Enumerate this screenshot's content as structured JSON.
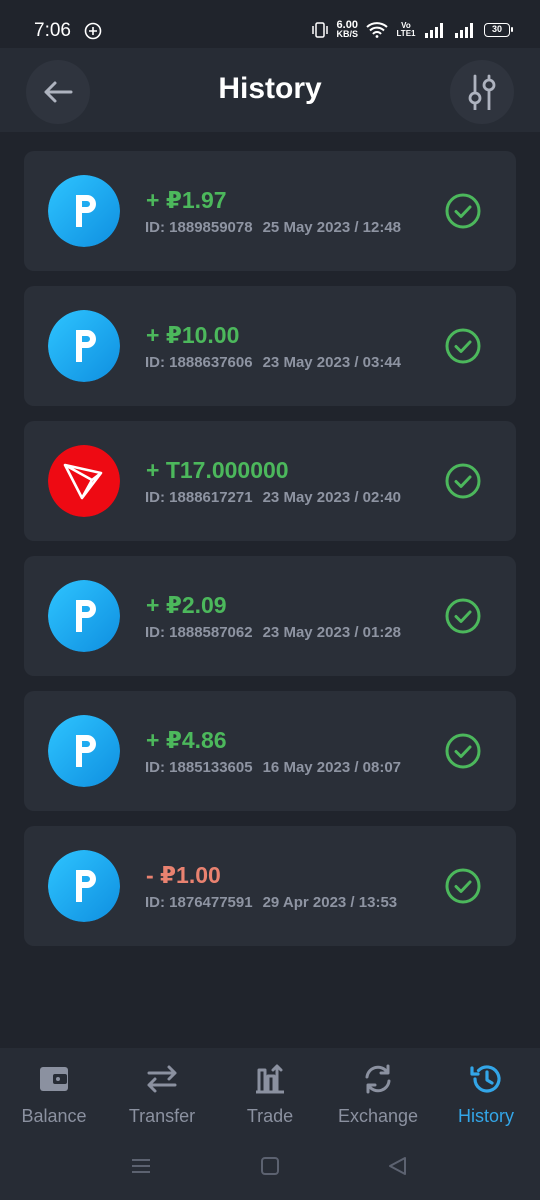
{
  "status_bar": {
    "time": "7:06",
    "speed_value": "6.00",
    "speed_unit": "KB/S",
    "network_label": "Vo LTE1",
    "battery": "30"
  },
  "header": {
    "title": "History"
  },
  "transactions": [
    {
      "icon": "p-currency-icon",
      "amount": "+ ₽1.97",
      "direction": "in",
      "id": "ID: 1889859078",
      "datetime": "25 May 2023 / 12:48"
    },
    {
      "icon": "p-currency-icon",
      "amount": "+ ₽10.00",
      "direction": "in",
      "id": "ID: 1888637606",
      "datetime": "23 May 2023 / 03:44"
    },
    {
      "icon": "tron-icon",
      "amount": "+ T17.000000",
      "direction": "in",
      "id": "ID: 1888617271",
      "datetime": "23 May 2023 / 02:40"
    },
    {
      "icon": "p-currency-icon",
      "amount": "+ ₽2.09",
      "direction": "in",
      "id": "ID: 1888587062",
      "datetime": "23 May 2023 / 01:28"
    },
    {
      "icon": "p-currency-icon",
      "amount": "+ ₽4.86",
      "direction": "in",
      "id": "ID: 1885133605",
      "datetime": "16 May 2023 / 08:07"
    },
    {
      "icon": "p-currency-icon",
      "amount": "- ₽1.00",
      "direction": "out",
      "id": "ID: 1876477591",
      "datetime": "29 Apr 2023 / 13:53"
    }
  ],
  "bottom_nav": {
    "items": [
      {
        "label": "Balance",
        "icon": "wallet-icon"
      },
      {
        "label": "Transfer",
        "icon": "transfer-arrows-icon"
      },
      {
        "label": "Trade",
        "icon": "trade-icon"
      },
      {
        "label": "Exchange",
        "icon": "exchange-icon"
      },
      {
        "label": "History",
        "icon": "history-icon"
      }
    ],
    "active": "History"
  },
  "colors": {
    "background": "#20242c",
    "card": "#2a2f38",
    "income": "#4cb85c",
    "outgo": "#e98270",
    "accent": "#33a6e8",
    "check": "#4cb85c"
  }
}
